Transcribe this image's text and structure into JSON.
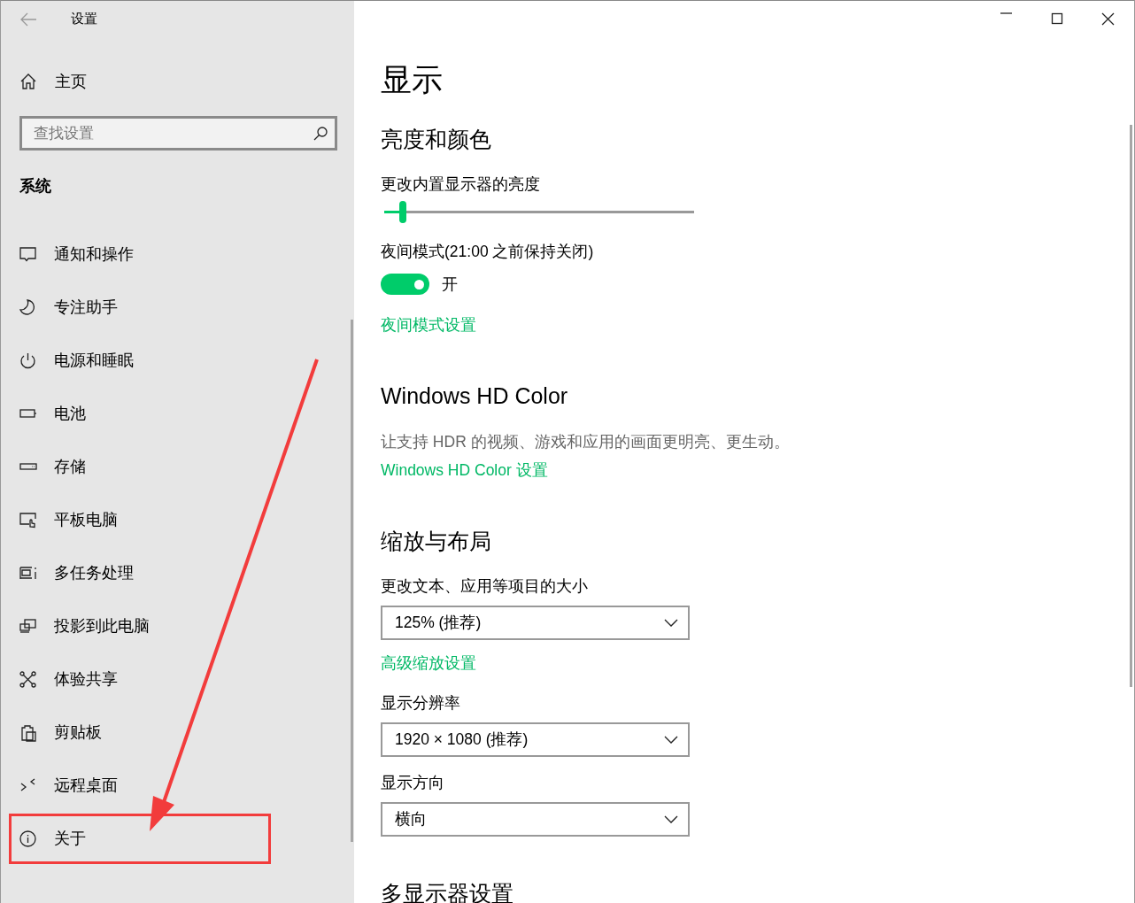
{
  "window": {
    "title": "设置"
  },
  "sidebar": {
    "home": "主页",
    "search": {
      "placeholder": "查找设置"
    },
    "section": "系统",
    "items": [
      {
        "label": "通知和操作",
        "selected": false,
        "highlighted": false
      },
      {
        "label": "专注助手",
        "selected": false,
        "highlighted": false
      },
      {
        "label": "电源和睡眠",
        "selected": false,
        "highlighted": false
      },
      {
        "label": "电池",
        "selected": false,
        "highlighted": false
      },
      {
        "label": "存储",
        "selected": false,
        "highlighted": false
      },
      {
        "label": "平板电脑",
        "selected": false,
        "highlighted": false
      },
      {
        "label": "多任务处理",
        "selected": false,
        "highlighted": false
      },
      {
        "label": "投影到此电脑",
        "selected": false,
        "highlighted": false
      },
      {
        "label": "体验共享",
        "selected": false,
        "highlighted": false
      },
      {
        "label": "剪贴板",
        "selected": false,
        "highlighted": false
      },
      {
        "label": "远程桌面",
        "selected": false,
        "highlighted": false
      },
      {
        "label": "关于",
        "selected": false,
        "highlighted": true
      }
    ]
  },
  "page": {
    "title": "显示",
    "sections": [
      {
        "heading": "亮度和颜色",
        "controls": [
          {
            "kind": "label",
            "text": "更改内置显示器的亮度"
          },
          {
            "kind": "slider",
            "level": 0.06
          },
          {
            "kind": "label",
            "text": "夜间模式(21:00 之前保持关闭)"
          },
          {
            "kind": "toggle",
            "on": true,
            "text": "开"
          },
          {
            "kind": "link",
            "text": "夜间模式设置"
          }
        ]
      },
      {
        "heading": "Windows HD Color",
        "controls": [
          {
            "kind": "description",
            "text": "让支持 HDR 的视频、游戏和应用的画面更明亮、更生动。"
          },
          {
            "kind": "link",
            "text": "Windows HD Color 设置"
          }
        ]
      },
      {
        "heading": "缩放与布局",
        "controls": [
          {
            "kind": "label",
            "text": "更改文本、应用等项目的大小"
          },
          {
            "kind": "dropdown",
            "value": "125% (推荐)"
          },
          {
            "kind": "link",
            "text": "高级缩放设置"
          },
          {
            "kind": "label",
            "text": "显示分辨率"
          },
          {
            "kind": "dropdown",
            "value": "1920 × 1080 (推荐)"
          },
          {
            "kind": "label",
            "text": "显示方向"
          },
          {
            "kind": "dropdown",
            "value": "横向"
          }
        ]
      },
      {
        "heading": "多显示器设置"
      }
    ]
  }
}
